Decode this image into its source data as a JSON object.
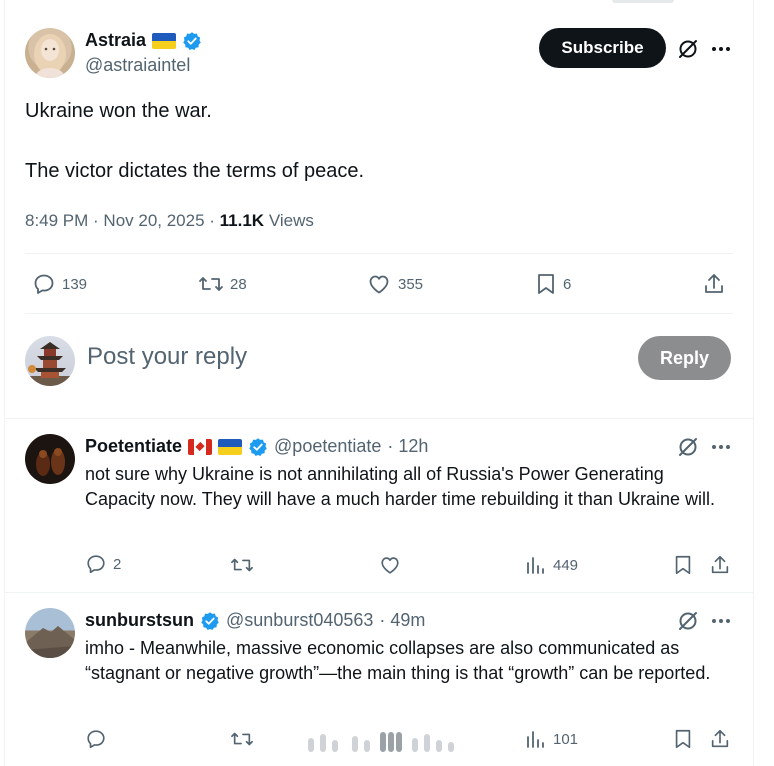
{
  "tweet": {
    "author_name": "Astraia",
    "author_handle": "@astraiaintel",
    "subscribe_label": "Subscribe",
    "line1": "Ukraine won the war.",
    "line2": "The victor dictates the terms of peace.",
    "time": "8:49 PM · Nov 20, 2025 · ",
    "views_count": "11.1K",
    "views_label": " Views",
    "replies": "139",
    "reposts": "28",
    "likes": "355",
    "bookmarks": "6"
  },
  "composer": {
    "placeholder": "Post your reply",
    "reply_label": "Reply"
  },
  "replies": [
    {
      "name": "Poetentiate",
      "handle": "@poetentiate",
      "time": "· 12h",
      "text": "not sure why Ukraine is not annihilating all of Russia's Power Generating Capacity now. They will have a much harder time rebuilding it than Ukraine will.",
      "replies": "2",
      "views": "449"
    },
    {
      "name": "sunburstsun",
      "handle": "@sunburst040563",
      "time": "· 49m",
      "text": "imho - Meanwhile, massive economic collapses are also communicated as “stagnant or negative growth”—the main thing is that “growth” can be reported.",
      "views": "101"
    }
  ],
  "colors": {
    "brand": "#1d9bf0",
    "text": "#0f1419",
    "muted": "#536471",
    "flag_ua_blue": "#1f5bbd",
    "flag_ua_yellow": "#f5cf1c",
    "flag_ca_red": "#d52b1e"
  }
}
